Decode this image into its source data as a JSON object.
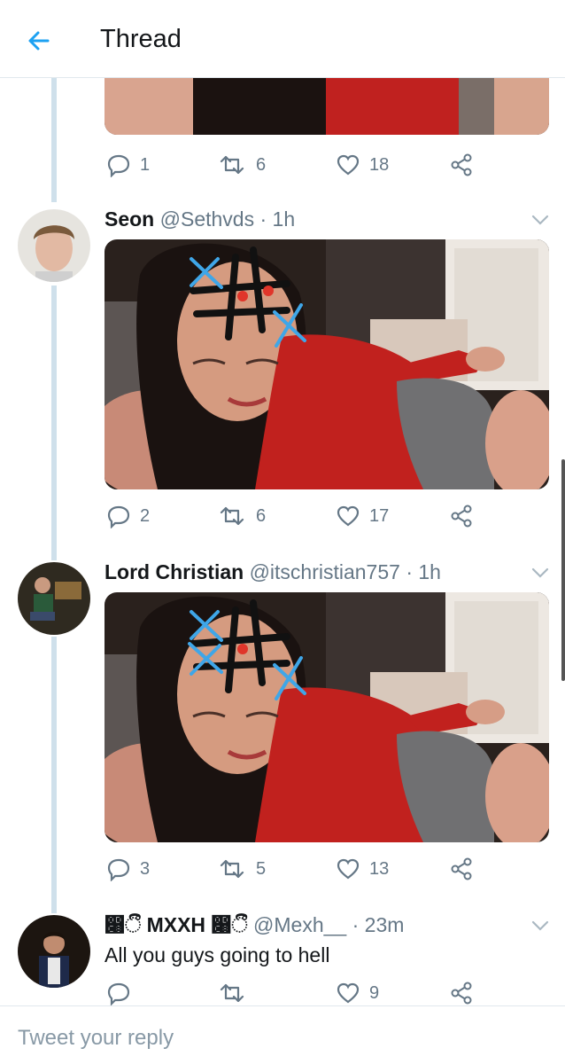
{
  "header": {
    "title": "Thread"
  },
  "top_tweet": {
    "replies": "1",
    "retweets": "6",
    "likes": "18"
  },
  "tweets": [
    {
      "name": "Seon",
      "handle": "@Sethvds",
      "separator": "·",
      "time": "1h",
      "replies": "2",
      "retweets": "6",
      "likes": "17"
    },
    {
      "name": "Lord Christian",
      "handle": "@itschristian757",
      "separator": "·",
      "time": "1h",
      "replies": "3",
      "retweets": "5",
      "likes": "13"
    },
    {
      "name": "෈ී MXXH ෈ී",
      "handle": "@Mexh__",
      "separator": "·",
      "time": "23m",
      "text": "All you guys going to hell",
      "replies": "",
      "retweets": "",
      "likes": "9"
    }
  ],
  "reply_bar": {
    "placeholder": "Tweet your reply"
  },
  "colors": {
    "accent": "#1da1f2",
    "muted": "#657786",
    "thread_line": "#cfe0eb"
  },
  "icons": [
    "back-arrow-icon",
    "reply-icon",
    "retweet-icon",
    "like-icon",
    "share-icon",
    "chevron-down-icon"
  ]
}
